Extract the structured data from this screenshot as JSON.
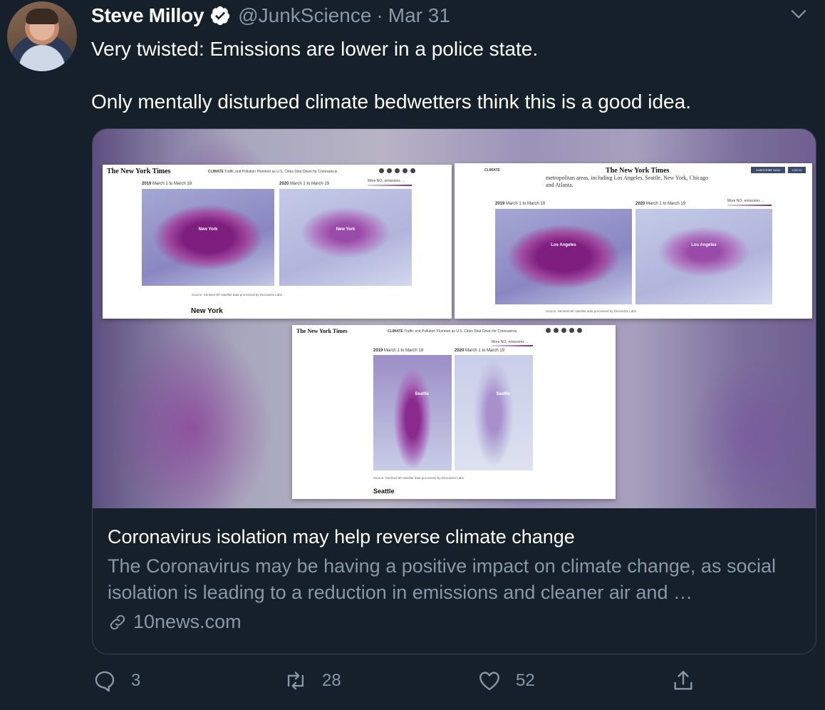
{
  "tweet": {
    "author_name": "Steve Milloy",
    "handle": "@JunkScience",
    "separator": "·",
    "date": "Mar 31",
    "text_line1": "Very twisted: Emissions are lower in a police state.",
    "text_line2": "Only mentally disturbed climate bedwetters think this is a good idea."
  },
  "card": {
    "title": "Coronavirus isolation may help reverse climate change",
    "description": "The Coronavirus may be having a positive impact on climate change, as social isolation is leading to a reduction in emissions and cleaner air and …",
    "domain": "10news.com",
    "image": {
      "masthead": "The New York Times",
      "section": "CLIMATE",
      "headline_nav": "Traffic and Pollution Plummet as U.S. Cities Shut Down for Coronavirus",
      "year_2019": "2019",
      "year_2020": "2020",
      "range": "March 1 to March 19",
      "legend_label": "More NO₂ emissions →",
      "source": "Source: Sentinel-5P satellite data processed by Descartes Labs",
      "ny_city": "New York",
      "ny_title": "New York",
      "la_city": "Los Angeles",
      "la_body": "metropolitan areas, including Los Angeles, Seattle, New York, Chicago and Atlanta.",
      "subscribe": "SUBSCRIBE NOW",
      "login": "LOG IN",
      "seattle_city": "Seattle",
      "seattle_title": "Seattle"
    }
  },
  "actions": {
    "replies": "3",
    "retweets": "28",
    "likes": "52"
  },
  "colors": {
    "background": "#15202b",
    "secondary_text": "#8899a6",
    "verified_badge": "#ffffff",
    "border": "#38444d"
  }
}
